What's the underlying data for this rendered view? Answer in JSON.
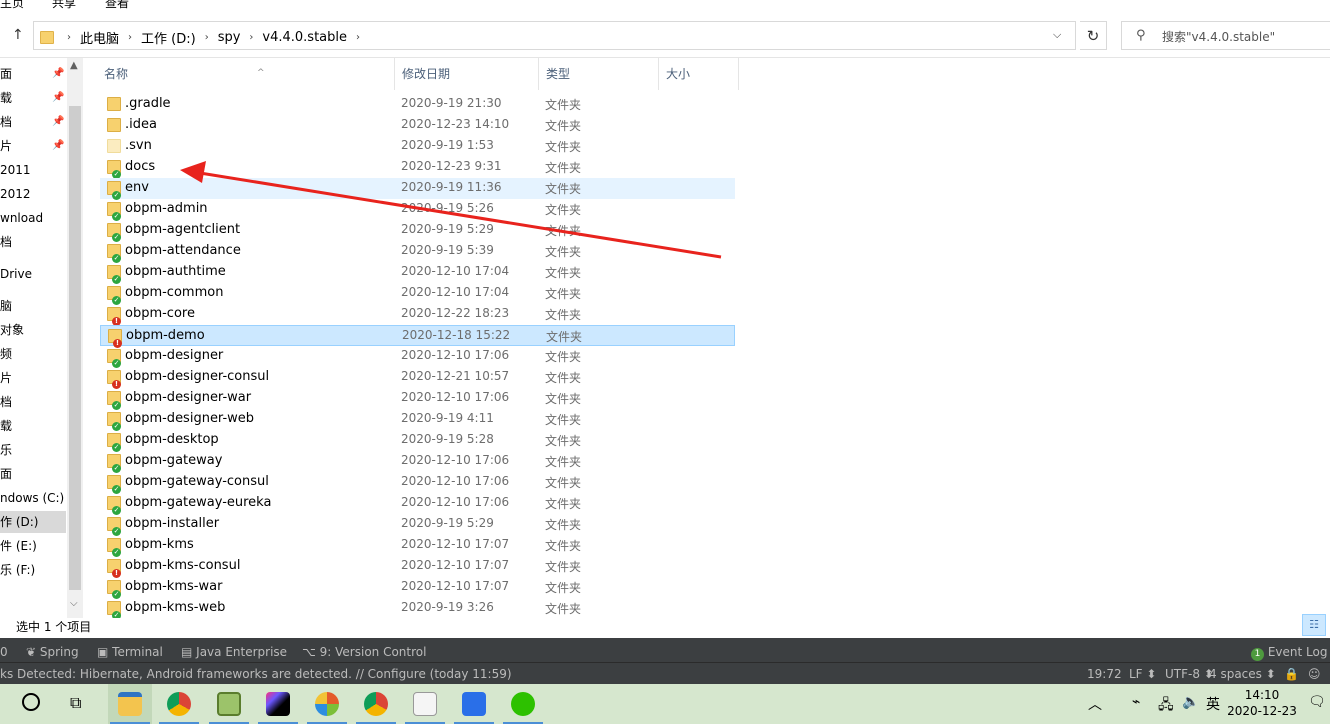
{
  "ribbon": {
    "tabs": [
      "主页",
      "共享",
      "查看"
    ]
  },
  "address": {
    "crumbs": [
      "此电脑",
      "工作 (D:)",
      "spy",
      "v4.4.0.stable"
    ],
    "search_placeholder": "搜索\"v4.4.0.stable\""
  },
  "sidebar": {
    "items": [
      {
        "label": "面",
        "pin": true
      },
      {
        "label": "载",
        "pin": true
      },
      {
        "label": "档",
        "pin": true
      },
      {
        "label": "片",
        "pin": true
      },
      {
        "label": "2011",
        "pin": false
      },
      {
        "label": "2012",
        "pin": false
      },
      {
        "label": "wnload",
        "pin": false
      },
      {
        "label": "档",
        "pin": false
      },
      {
        "label": "Drive",
        "pin": false
      },
      {
        "label": "脑",
        "pin": false
      },
      {
        "label": "对象",
        "pin": false
      },
      {
        "label": "频",
        "pin": false
      },
      {
        "label": "片",
        "pin": false
      },
      {
        "label": "档",
        "pin": false
      },
      {
        "label": "载",
        "pin": false
      },
      {
        "label": "乐",
        "pin": false
      },
      {
        "label": "面",
        "pin": false
      },
      {
        "label": "ndows (C:)",
        "pin": false
      },
      {
        "label": "作 (D:)",
        "pin": false
      },
      {
        "label": "件 (E:)",
        "pin": false
      },
      {
        "label": "乐 (F:)",
        "pin": false
      }
    ]
  },
  "columns": {
    "name": "名称",
    "date": "修改日期",
    "type": "类型",
    "size": "大小"
  },
  "files": [
    {
      "name": ".gradle",
      "date": "2020-9-19 21:30",
      "type": "文件夹",
      "badge": "none",
      "state": ""
    },
    {
      "name": ".idea",
      "date": "2020-12-23 14:10",
      "type": "文件夹",
      "badge": "none",
      "state": ""
    },
    {
      "name": ".svn",
      "date": "2020-9-19 1:53",
      "type": "文件夹",
      "badge": "svn",
      "state": ""
    },
    {
      "name": "docs",
      "date": "2020-12-23 9:31",
      "type": "文件夹",
      "badge": "ok",
      "state": ""
    },
    {
      "name": "env",
      "date": "2020-9-19 11:36",
      "type": "文件夹",
      "badge": "ok",
      "state": "hover"
    },
    {
      "name": "obpm-admin",
      "date": "2020-9-19 5:26",
      "type": "文件夹",
      "badge": "ok",
      "state": ""
    },
    {
      "name": "obpm-agentclient",
      "date": "2020-9-19 5:29",
      "type": "文件夹",
      "badge": "ok",
      "state": ""
    },
    {
      "name": "obpm-attendance",
      "date": "2020-9-19 5:39",
      "type": "文件夹",
      "badge": "ok",
      "state": ""
    },
    {
      "name": "obpm-authtime",
      "date": "2020-12-10 17:04",
      "type": "文件夹",
      "badge": "ok",
      "state": ""
    },
    {
      "name": "obpm-common",
      "date": "2020-12-10 17:04",
      "type": "文件夹",
      "badge": "ok",
      "state": ""
    },
    {
      "name": "obpm-core",
      "date": "2020-12-22 18:23",
      "type": "文件夹",
      "badge": "err",
      "state": ""
    },
    {
      "name": "obpm-demo",
      "date": "2020-12-18 15:22",
      "type": "文件夹",
      "badge": "err",
      "state": "sel"
    },
    {
      "name": "obpm-designer",
      "date": "2020-12-10 17:06",
      "type": "文件夹",
      "badge": "ok",
      "state": ""
    },
    {
      "name": "obpm-designer-consul",
      "date": "2020-12-21 10:57",
      "type": "文件夹",
      "badge": "err",
      "state": ""
    },
    {
      "name": "obpm-designer-war",
      "date": "2020-12-10 17:06",
      "type": "文件夹",
      "badge": "ok",
      "state": ""
    },
    {
      "name": "obpm-designer-web",
      "date": "2020-9-19 4:11",
      "type": "文件夹",
      "badge": "ok",
      "state": ""
    },
    {
      "name": "obpm-desktop",
      "date": "2020-9-19 5:28",
      "type": "文件夹",
      "badge": "ok",
      "state": ""
    },
    {
      "name": "obpm-gateway",
      "date": "2020-12-10 17:06",
      "type": "文件夹",
      "badge": "ok",
      "state": ""
    },
    {
      "name": "obpm-gateway-consul",
      "date": "2020-12-10 17:06",
      "type": "文件夹",
      "badge": "ok",
      "state": ""
    },
    {
      "name": "obpm-gateway-eureka",
      "date": "2020-12-10 17:06",
      "type": "文件夹",
      "badge": "ok",
      "state": ""
    },
    {
      "name": "obpm-installer",
      "date": "2020-9-19 5:29",
      "type": "文件夹",
      "badge": "ok",
      "state": ""
    },
    {
      "name": "obpm-kms",
      "date": "2020-12-10 17:07",
      "type": "文件夹",
      "badge": "ok",
      "state": ""
    },
    {
      "name": "obpm-kms-consul",
      "date": "2020-12-10 17:07",
      "type": "文件夹",
      "badge": "err",
      "state": ""
    },
    {
      "name": "obpm-kms-war",
      "date": "2020-12-10 17:07",
      "type": "文件夹",
      "badge": "ok",
      "state": ""
    },
    {
      "name": "obpm-kms-web",
      "date": "2020-9-19 3:26",
      "type": "文件夹",
      "badge": "ok",
      "state": ""
    }
  ],
  "status": {
    "selection": "选中 1 个项目"
  },
  "ide_tabs": [
    "0",
    "Spring",
    "Terminal",
    "Java Enterprise",
    "9: Version Control",
    "Event Log"
  ],
  "ide_event_count": "1",
  "ide_status": {
    "message": "ks Detected: Hibernate, Android frameworks are detected. // Configure (today 11:59)",
    "position": "19:72",
    "line_sep": "LF ⬍",
    "encoding": "UTF-8 ⬍",
    "indent": "4 spaces ⬍"
  },
  "tray": {
    "ime": "英",
    "time": "14:10",
    "date": "2020-12-23"
  },
  "colors": {
    "ide_bg": "#3c3f41",
    "taskbar_bg": "#d6e7ce",
    "selection": "#cce8ff",
    "arrow": "#e8231d"
  }
}
